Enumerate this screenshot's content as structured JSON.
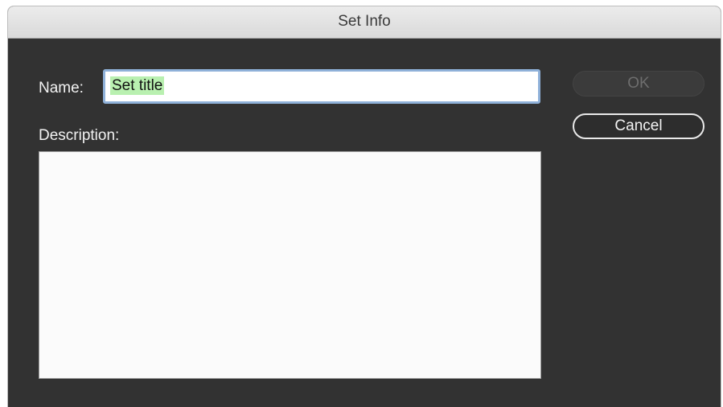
{
  "window": {
    "title": "Set Info"
  },
  "form": {
    "name_label": "Name:",
    "name_value": "Set title",
    "description_label": "Description:",
    "description_value": ""
  },
  "buttons": {
    "ok_label": "OK",
    "ok_enabled": false,
    "cancel_label": "Cancel"
  },
  "colors": {
    "dialog_background": "#323232",
    "name_selection_highlight": "#b9f0b0",
    "focus_ring": "#8fb1d9"
  }
}
